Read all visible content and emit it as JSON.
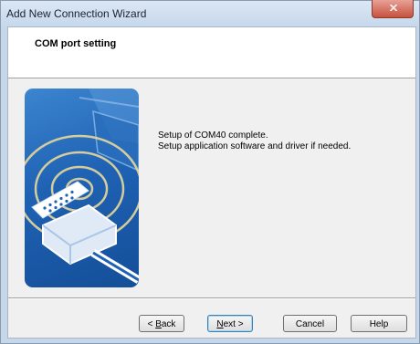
{
  "window": {
    "title": "Add New Connection Wizard"
  },
  "header": {
    "title": "COM port setting"
  },
  "message": {
    "line1": "Setup of COM40 complete.",
    "line2": " Setup application software and driver if needed."
  },
  "buttons": {
    "back": {
      "mnemonic": "B",
      "rest": "ack"
    },
    "next": {
      "mnemonic": "N",
      "rest": "ext >"
    },
    "cancel": "Cancel",
    "help": "Help"
  },
  "icons": {
    "close": "close-icon",
    "illustration": "serial-cable-illustration"
  },
  "colors": {
    "accent": "#1f62b4",
    "titlebar": "#c7d7ea",
    "close": "#c6513e"
  }
}
